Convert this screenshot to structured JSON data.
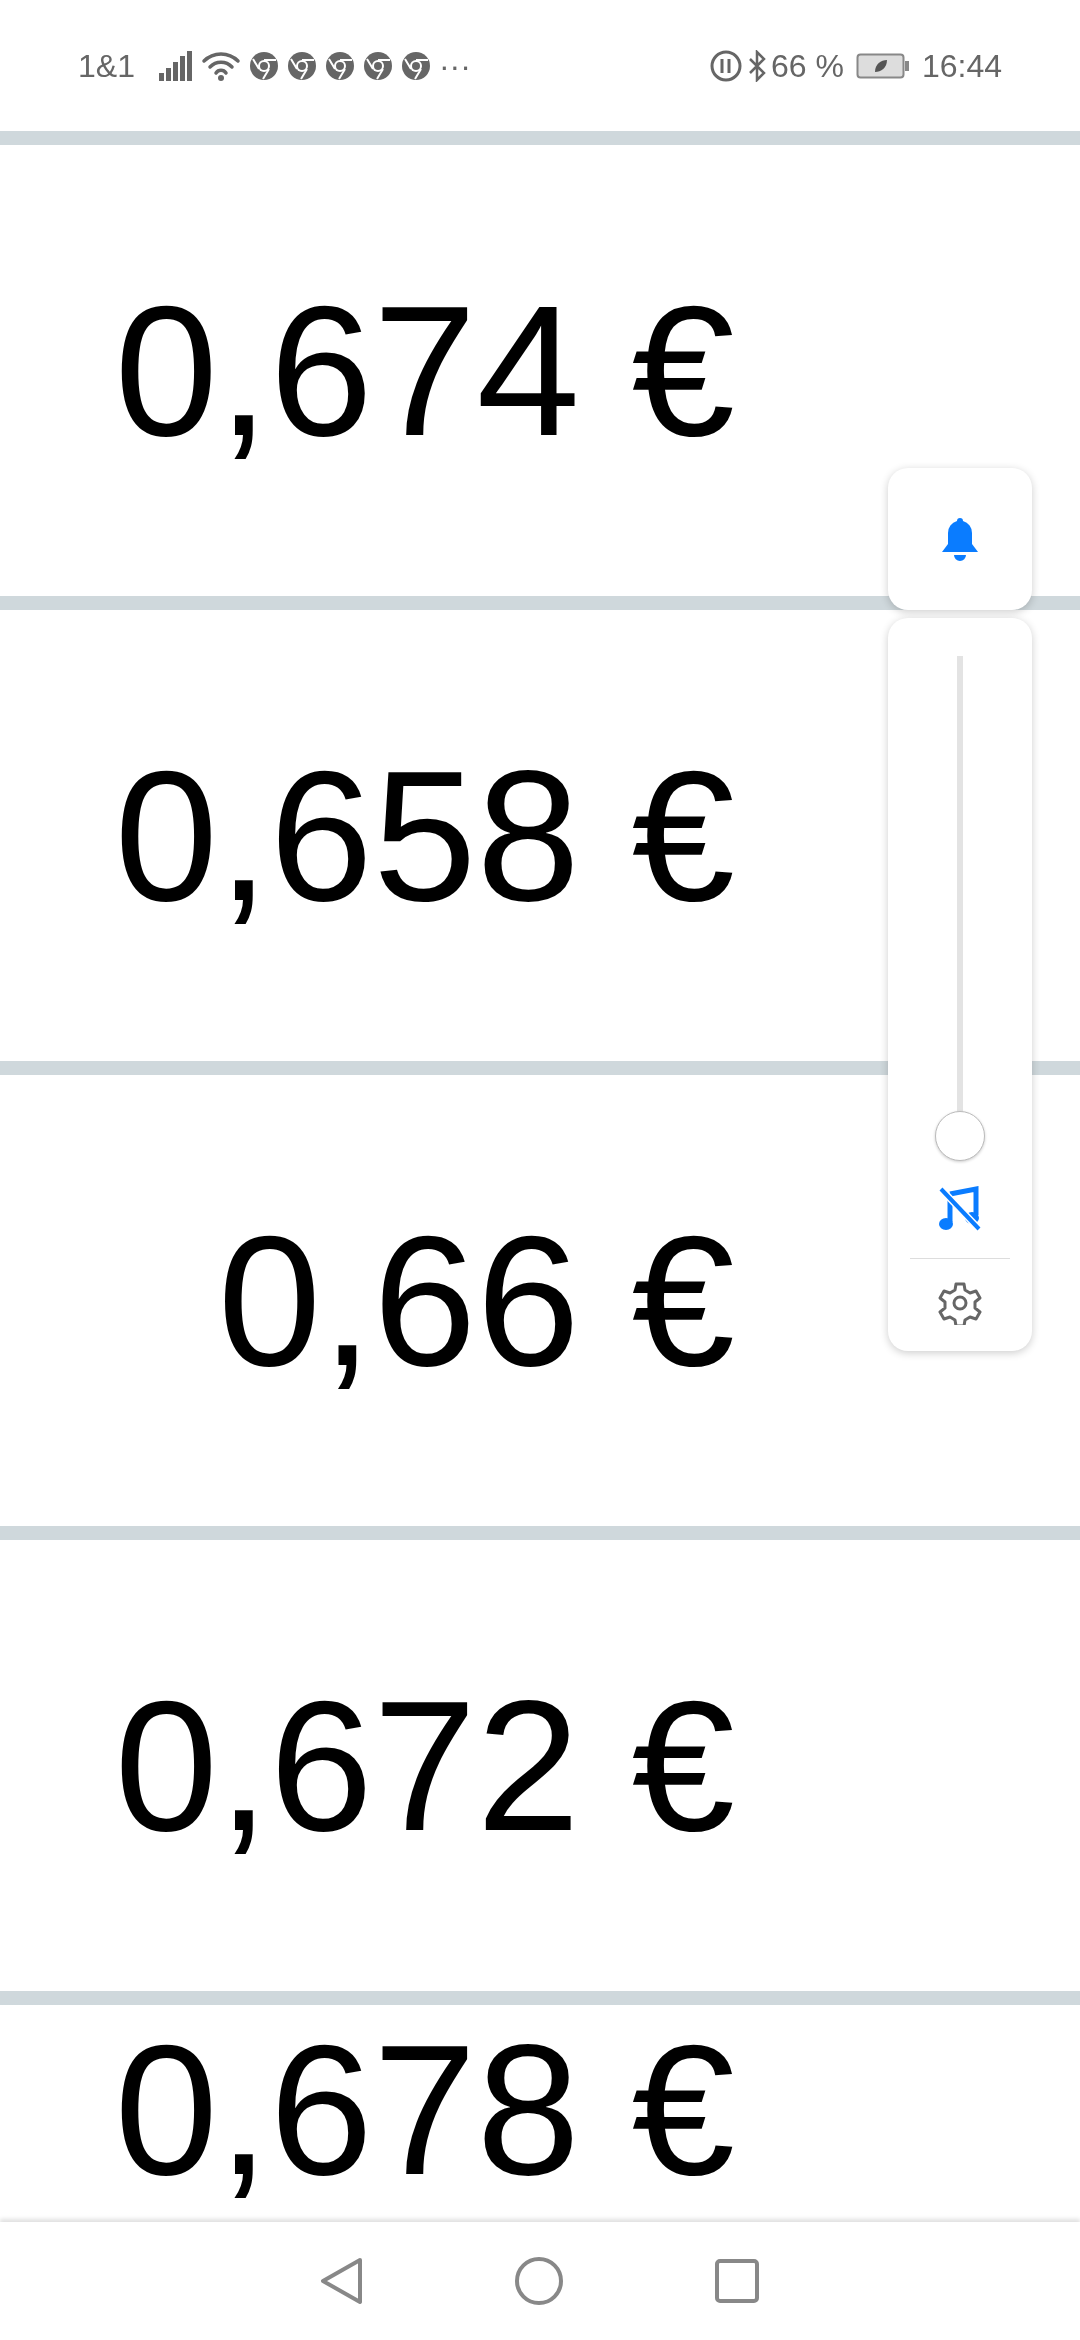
{
  "status_bar": {
    "carrier": "1&1",
    "notification_icons": [
      {
        "kind": "app"
      },
      {
        "kind": "app"
      },
      {
        "kind": "app"
      },
      {
        "kind": "app"
      },
      {
        "kind": "app"
      }
    ],
    "overflow": "···",
    "battery": "66 %",
    "time": "16:44"
  },
  "prices": [
    {
      "value": "0,674 €"
    },
    {
      "value": "0,658 €"
    },
    {
      "value": "0,66 €"
    },
    {
      "value": "0,672 €"
    },
    {
      "value": "0,678 €"
    }
  ],
  "volume_panel": {
    "level": 0,
    "music_muted": true
  }
}
